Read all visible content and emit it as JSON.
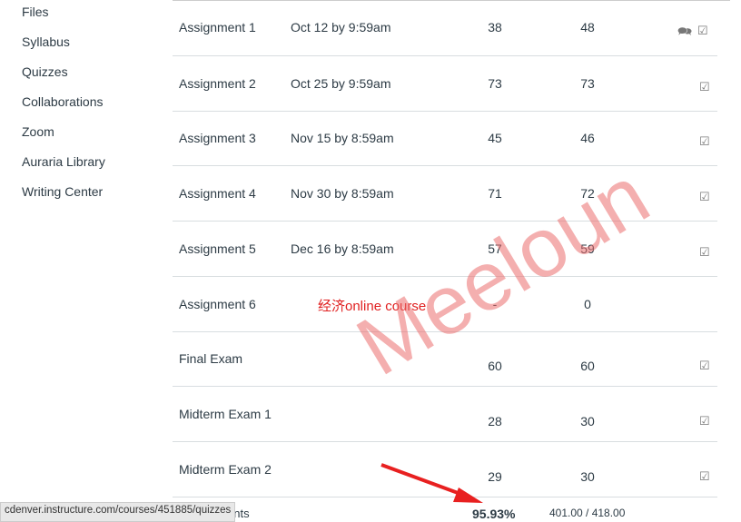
{
  "nav": [
    "Files",
    "Syllabus",
    "Quizzes",
    "Collaborations",
    "Zoom",
    "Auraria Library",
    "Writing Center"
  ],
  "rows": [
    {
      "name": "Assignment 1",
      "due": "Oct 12 by 9:59am",
      "score": "38",
      "out_of": "48",
      "icons": [
        "comment-icon",
        "rubric-icon"
      ]
    },
    {
      "name": "Assignment 2",
      "due": "Oct 25 by 9:59am",
      "score": "73",
      "out_of": "73",
      "icons": [
        "rubric-icon"
      ]
    },
    {
      "name": "Assignment 3",
      "due": "Nov 15 by 8:59am",
      "score": "45",
      "out_of": "46",
      "icons": [
        "rubric-icon"
      ]
    },
    {
      "name": "Assignment 4",
      "due": "Nov 30 by 8:59am",
      "score": "71",
      "out_of": "72",
      "icons": [
        "rubric-icon"
      ]
    },
    {
      "name": "Assignment 5",
      "due": "Dec 16 by 8:59am",
      "score": "57",
      "out_of": "59",
      "icons": [
        "rubric-icon"
      ]
    },
    {
      "name": "Assignment 6",
      "due": "",
      "score": "-",
      "out_of": "0",
      "icons": []
    },
    {
      "name": "Final Exam",
      "due": "",
      "score": "60",
      "out_of": "60",
      "icons": [
        "rubric-icon"
      ]
    },
    {
      "name": "Midterm Exam 1",
      "due": "",
      "score": "28",
      "out_of": "30",
      "icons": [
        "rubric-icon"
      ]
    },
    {
      "name": "Midterm Exam 2",
      "due": "",
      "score": "29",
      "out_of": "30",
      "icons": [
        "rubric-icon"
      ]
    }
  ],
  "total": {
    "label": "ents",
    "percent": "95.93%",
    "points": "401.00 / 418.00"
  },
  "status_url": "cdenver.instructure.com/courses/451885/quizzes",
  "watermark": "Meeloun",
  "overlay_text": "经济online course"
}
